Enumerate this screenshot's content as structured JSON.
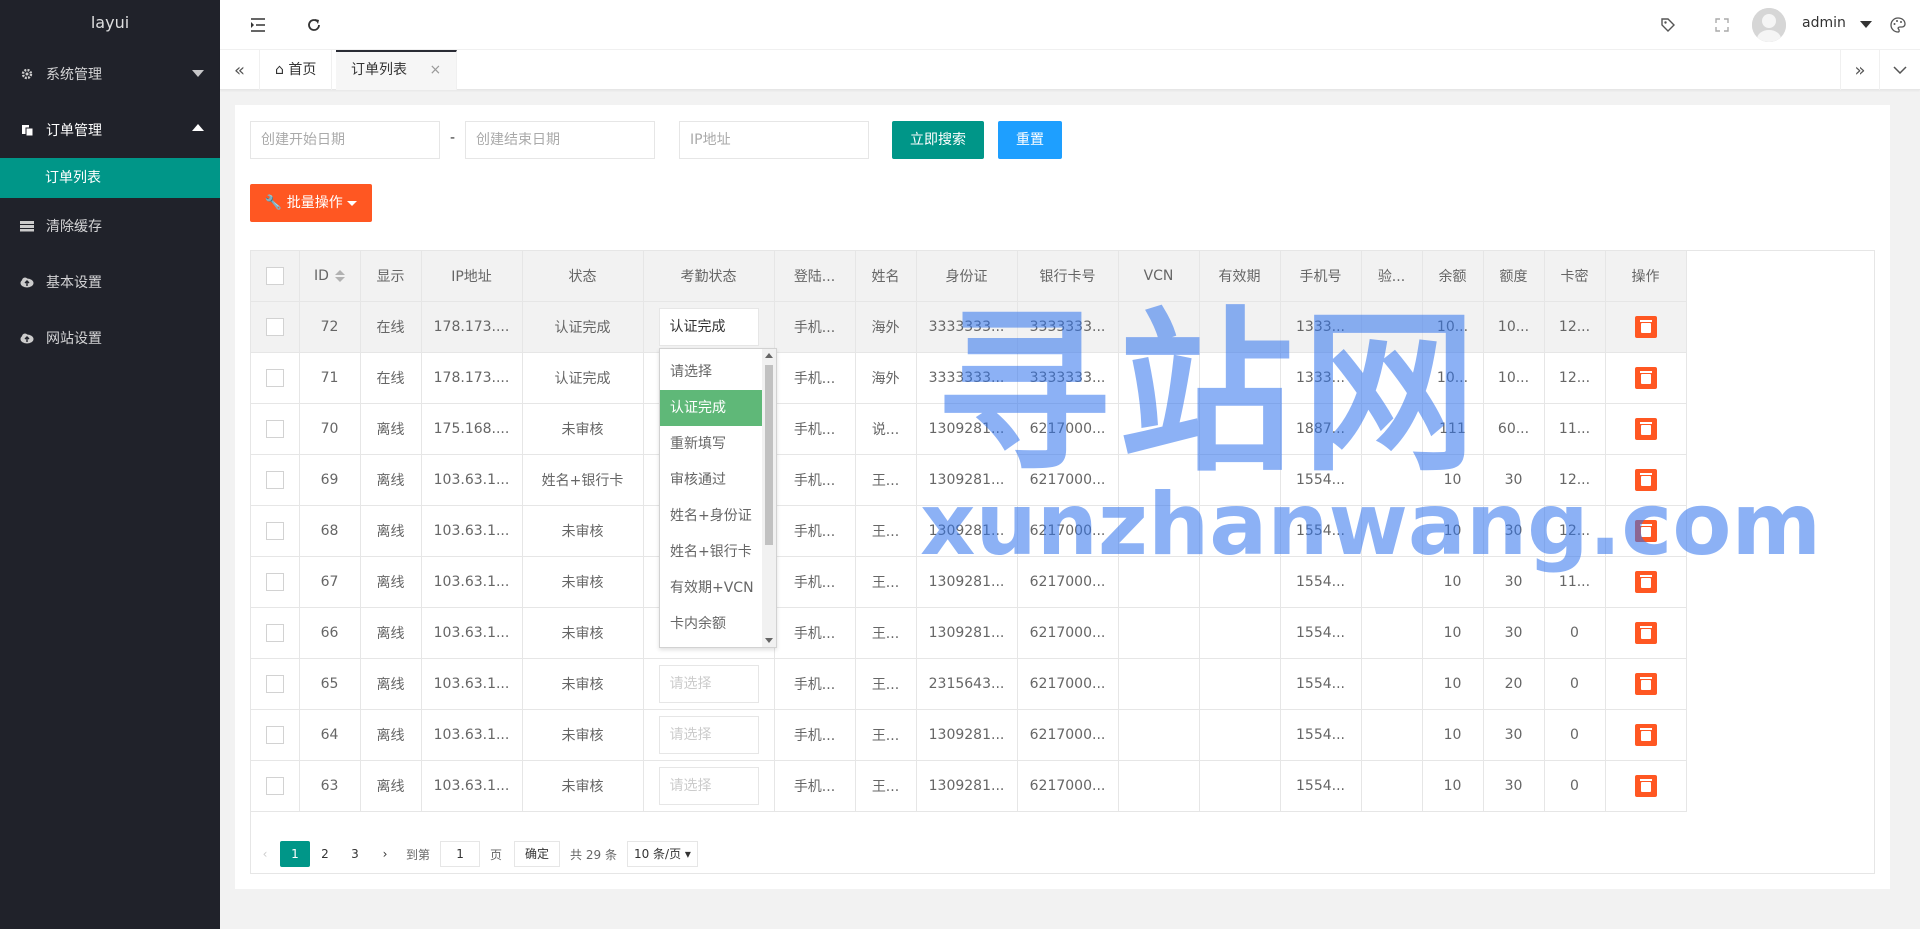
{
  "app": {
    "logo": "layui"
  },
  "sidebar": {
    "items": [
      {
        "label": "系统管理",
        "icon": "gear-icon",
        "state": "collapsed"
      },
      {
        "label": "订单管理",
        "icon": "copy-icon",
        "state": "expanded"
      },
      {
        "label": "清除缓存",
        "icon": "storage-icon"
      },
      {
        "label": "基本设置",
        "icon": "cloud-upload-icon"
      },
      {
        "label": "网站设置",
        "icon": "cloud-upload-icon"
      }
    ],
    "sub_items": [
      {
        "label": "订单列表",
        "active": true
      }
    ]
  },
  "header": {
    "user": "admin",
    "icons": [
      "menu-fold-icon",
      "refresh-icon",
      "tag-icon",
      "fullscreen-icon",
      "theme-icon"
    ]
  },
  "tabs": [
    {
      "label": "首页",
      "icon": "home-icon"
    },
    {
      "label": "订单列表",
      "active": true,
      "close": "×"
    }
  ],
  "filters": {
    "start_date_placeholder": "创建开始日期",
    "separator": "-",
    "end_date_placeholder": "创建结束日期",
    "ip_placeholder": "IP地址",
    "search_label": "立即搜索",
    "reset_label": "重置",
    "batch_label": "批量操作"
  },
  "table": {
    "columns": [
      "",
      "ID",
      "显示",
      "IP地址",
      "状态",
      "考勤状态",
      "登陆...",
      "姓名",
      "身份证",
      "银行卡号",
      "VCN",
      "有效期",
      "手机号",
      "验...",
      "余额",
      "额度",
      "卡密",
      "操作"
    ],
    "rows": [
      {
        "id": "72",
        "show": "在线",
        "ip": "178.173....",
        "status": "认证完成",
        "att": "认证完成",
        "login": "手机...",
        "name": "海外",
        "idcard": "3333333...",
        "bank": "3333333...",
        "vcn": "",
        "exp": "",
        "phone": "1333...",
        "verify": "",
        "balance": "10...",
        "quota": "10...",
        "card": "12..."
      },
      {
        "id": "71",
        "show": "在线",
        "ip": "178.173....",
        "status": "认证完成",
        "att": "",
        "login": "手机...",
        "name": "海外",
        "idcard": "3333333...",
        "bank": "3333333...",
        "vcn": "",
        "exp": "",
        "phone": "1333...",
        "verify": "",
        "balance": "10...",
        "quota": "10...",
        "card": "12..."
      },
      {
        "id": "70",
        "show": "离线",
        "ip": "175.168....",
        "status": "未审核",
        "att": "",
        "login": "手机...",
        "name": "说...",
        "idcard": "1309281...",
        "bank": "6217000...",
        "vcn": "",
        "exp": "",
        "phone": "1887...",
        "verify": "",
        "balance": "111",
        "quota": "60...",
        "card": "11..."
      },
      {
        "id": "69",
        "show": "离线",
        "ip": "103.63.1...",
        "status": "姓名+银行卡",
        "att": "",
        "login": "手机...",
        "name": "王...",
        "idcard": "1309281...",
        "bank": "6217000...",
        "vcn": "",
        "exp": "",
        "phone": "1554...",
        "verify": "",
        "balance": "10",
        "quota": "30",
        "card": "12..."
      },
      {
        "id": "68",
        "show": "离线",
        "ip": "103.63.1...",
        "status": "未审核",
        "att": "",
        "login": "手机...",
        "name": "王...",
        "idcard": "1309281...",
        "bank": "6217000...",
        "vcn": "",
        "exp": "",
        "phone": "1554...",
        "verify": "",
        "balance": "10",
        "quota": "30",
        "card": "12..."
      },
      {
        "id": "67",
        "show": "离线",
        "ip": "103.63.1...",
        "status": "未审核",
        "att": "",
        "login": "手机...",
        "name": "王...",
        "idcard": "1309281...",
        "bank": "6217000...",
        "vcn": "",
        "exp": "",
        "phone": "1554...",
        "verify": "",
        "balance": "10",
        "quota": "30",
        "card": "11..."
      },
      {
        "id": "66",
        "show": "离线",
        "ip": "103.63.1...",
        "status": "未审核",
        "att": "",
        "login": "手机...",
        "name": "王...",
        "idcard": "1309281...",
        "bank": "6217000...",
        "vcn": "",
        "exp": "",
        "phone": "1554...",
        "verify": "",
        "balance": "10",
        "quota": "30",
        "card": "0"
      },
      {
        "id": "65",
        "show": "离线",
        "ip": "103.63.1...",
        "status": "未审核",
        "att": "请选择",
        "login": "手机...",
        "name": "王...",
        "idcard": "2315643...",
        "bank": "6217000...",
        "vcn": "",
        "exp": "",
        "phone": "1554...",
        "verify": "",
        "balance": "10",
        "quota": "20",
        "card": "0"
      },
      {
        "id": "64",
        "show": "离线",
        "ip": "103.63.1...",
        "status": "未审核",
        "att": "请选择",
        "login": "手机...",
        "name": "王...",
        "idcard": "1309281...",
        "bank": "6217000...",
        "vcn": "",
        "exp": "",
        "phone": "1554...",
        "verify": "",
        "balance": "10",
        "quota": "30",
        "card": "0"
      },
      {
        "id": "63",
        "show": "离线",
        "ip": "103.63.1...",
        "status": "未审核",
        "att": "请选择",
        "login": "手机...",
        "name": "王...",
        "idcard": "1309281...",
        "bank": "6217000...",
        "vcn": "",
        "exp": "",
        "phone": "1554...",
        "verify": "",
        "balance": "10",
        "quota": "30",
        "card": "0"
      }
    ]
  },
  "dropdown": {
    "options": [
      "请选择",
      "认证完成",
      "重新填写",
      "审核通过",
      "姓名+身份证",
      "姓名+银行卡",
      "有效期+VCN",
      "卡内余额"
    ],
    "selected": "认证完成"
  },
  "pager": {
    "pages": [
      "1",
      "2",
      "3"
    ],
    "current": "1",
    "goto_label": "到第",
    "goto_value": "1",
    "page_unit": "页",
    "confirm_label": "确定",
    "total_label": "共 29 条",
    "limit_label": "10 条/页"
  },
  "watermark": {
    "big": "寻站网",
    "small": "xunzhanwang.com"
  }
}
